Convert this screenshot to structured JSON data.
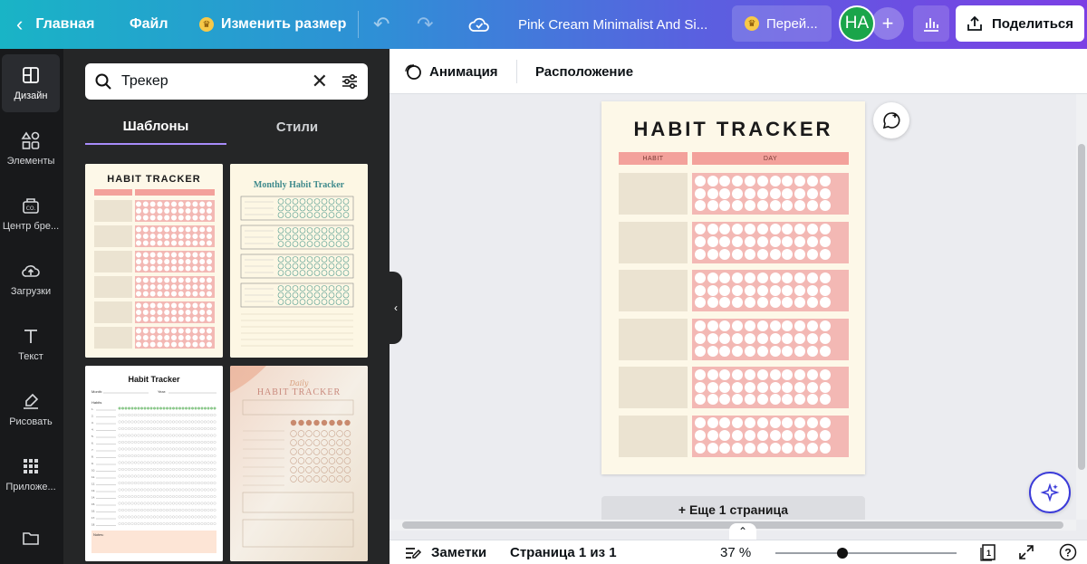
{
  "topbar": {
    "home": "Главная",
    "file": "Файл",
    "resize": "Изменить размер",
    "title": "Pink Cream Minimalist And Si...",
    "upgrade": "Перей...",
    "avatar_initials": "НА",
    "share": "Поделиться",
    "gradient_start": "#19b4c6",
    "gradient_end": "#7b3fe4"
  },
  "rail": {
    "items": [
      {
        "label": "Дизайн",
        "icon": "layout-icon"
      },
      {
        "label": "Элементы",
        "icon": "shapes-icon"
      },
      {
        "label": "Центр бре...",
        "icon": "brand-icon"
      },
      {
        "label": "Загрузки",
        "icon": "cloud-upload-icon"
      },
      {
        "label": "Текст",
        "icon": "text-icon"
      },
      {
        "label": "Рисовать",
        "icon": "draw-icon"
      },
      {
        "label": "Приложе...",
        "icon": "apps-icon"
      }
    ]
  },
  "panel": {
    "search_value": "Трекер",
    "tabs": [
      "Шаблоны",
      "Стили"
    ],
    "thumbnails": [
      {
        "title": "HABIT TRACKER"
      },
      {
        "title": "Monthly Habit Tracker"
      },
      {
        "title": "Habit Tracker",
        "fields": [
          "Month:",
          "Year:",
          "Habits",
          "Notes:"
        ]
      },
      {
        "title": "HABIT TRACKER",
        "script": "Daily"
      }
    ]
  },
  "toolbar": {
    "animation": "Анимация",
    "position": "Расположение"
  },
  "design": {
    "title": "HABIT TRACKER",
    "col_habit": "HABIT",
    "col_day": "DAY",
    "rows": 6,
    "dots_per_row": 33
  },
  "canvas": {
    "add_page": "+ Еще 1 страница"
  },
  "bottombar": {
    "notes": "Заметки",
    "page": "Страница 1 из 1",
    "zoom": "37 %",
    "zoom_fraction": 0.37,
    "page_count_badge": "1",
    "help": "?"
  }
}
